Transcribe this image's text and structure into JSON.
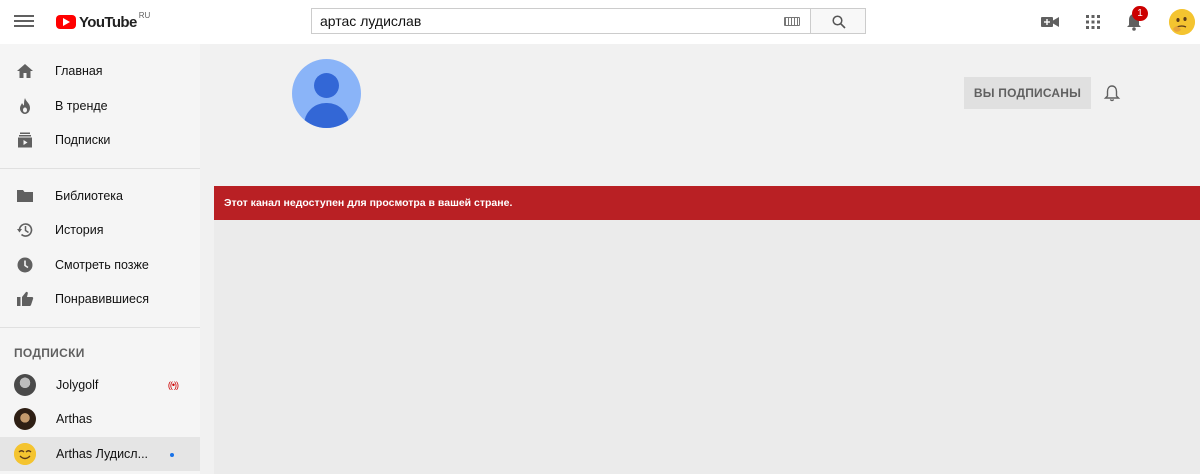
{
  "header": {
    "logo_text": "YouTube",
    "logo_region": "RU",
    "search_value": "артас лудислав",
    "notification_count": "1"
  },
  "sidebar": {
    "main_items": [
      {
        "label": "Главная",
        "icon": "home-icon"
      },
      {
        "label": "В тренде",
        "icon": "fire-icon"
      },
      {
        "label": "Подписки",
        "icon": "subscriptions-icon"
      }
    ],
    "library_items": [
      {
        "label": "Библиотека",
        "icon": "folder-icon"
      },
      {
        "label": "История",
        "icon": "history-icon"
      },
      {
        "label": "Смотреть позже",
        "icon": "clock-icon"
      },
      {
        "label": "Понравившиеся",
        "icon": "thumbs-up-icon"
      }
    ],
    "subscriptions_heading": "ПОДПИСКИ",
    "subscriptions": [
      {
        "name": "Jolygolf",
        "indicator": "((•))",
        "avatar_color": "#6b6b6b"
      },
      {
        "name": "Arthas",
        "avatar_color": "#4a3426"
      },
      {
        "name": "Arthas Лудисл...",
        "avatar_color": "#f4c430",
        "active": true
      }
    ]
  },
  "channel": {
    "subscribe_label": "ВЫ ПОДПИСАНЫ"
  },
  "error": {
    "message": "Этот канал недоступен для просмотра в вашей стране."
  },
  "colors": {
    "brand_red": "#ff0000",
    "banner_red": "#b92024",
    "avatar_blue": "#3367d6"
  }
}
